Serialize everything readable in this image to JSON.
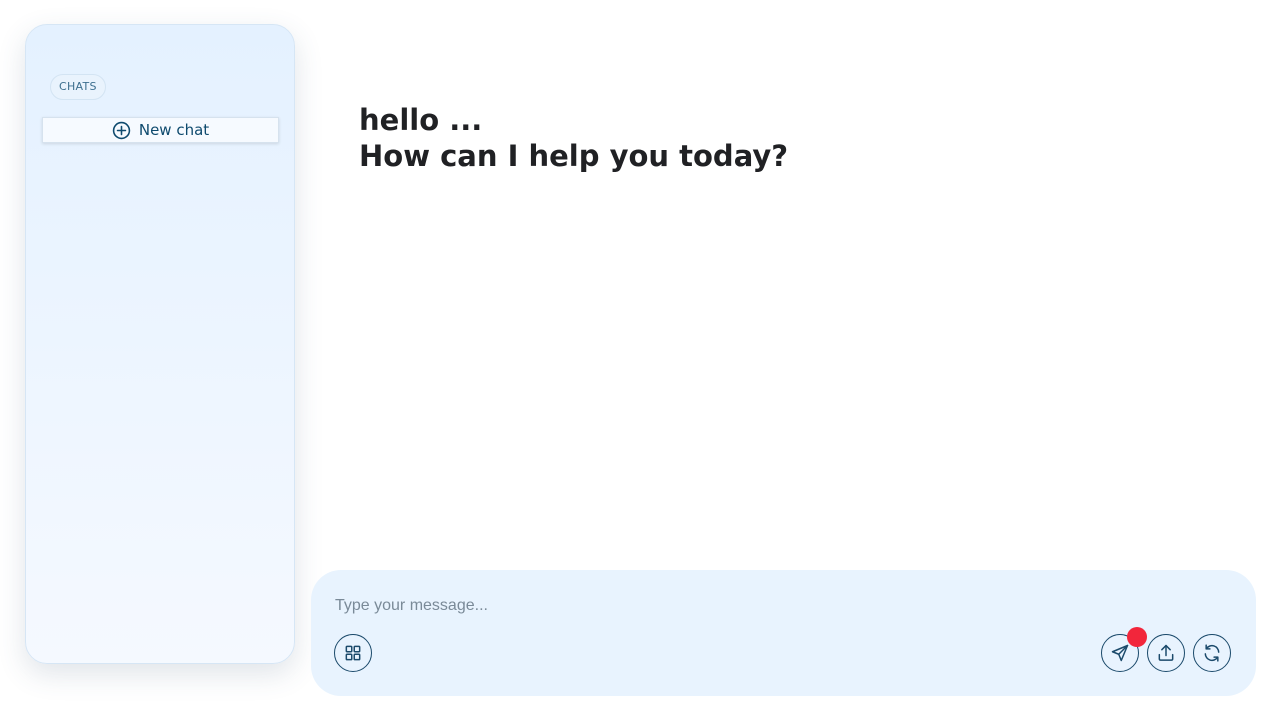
{
  "sidebar": {
    "section_label": "CHATS",
    "new_chat_label": "New chat",
    "new_chat_icon": "plus-circle-icon"
  },
  "greeting": {
    "line1": "hello ...",
    "line2": "How can I help you today?"
  },
  "composer": {
    "placeholder": "Type your message...",
    "value": "",
    "buttons": [
      {
        "name": "apps",
        "icon": "grid-icon"
      },
      {
        "name": "send",
        "icon": "paper-plane-icon"
      },
      {
        "name": "upload",
        "icon": "upload-icon"
      },
      {
        "name": "refresh",
        "icon": "refresh-icon"
      }
    ]
  },
  "colors": {
    "accent": "#0e4a6e",
    "notification": "#f2263b",
    "composer_bg": "#e8f3fe",
    "sidebar_bg": "#e4f1ff"
  }
}
